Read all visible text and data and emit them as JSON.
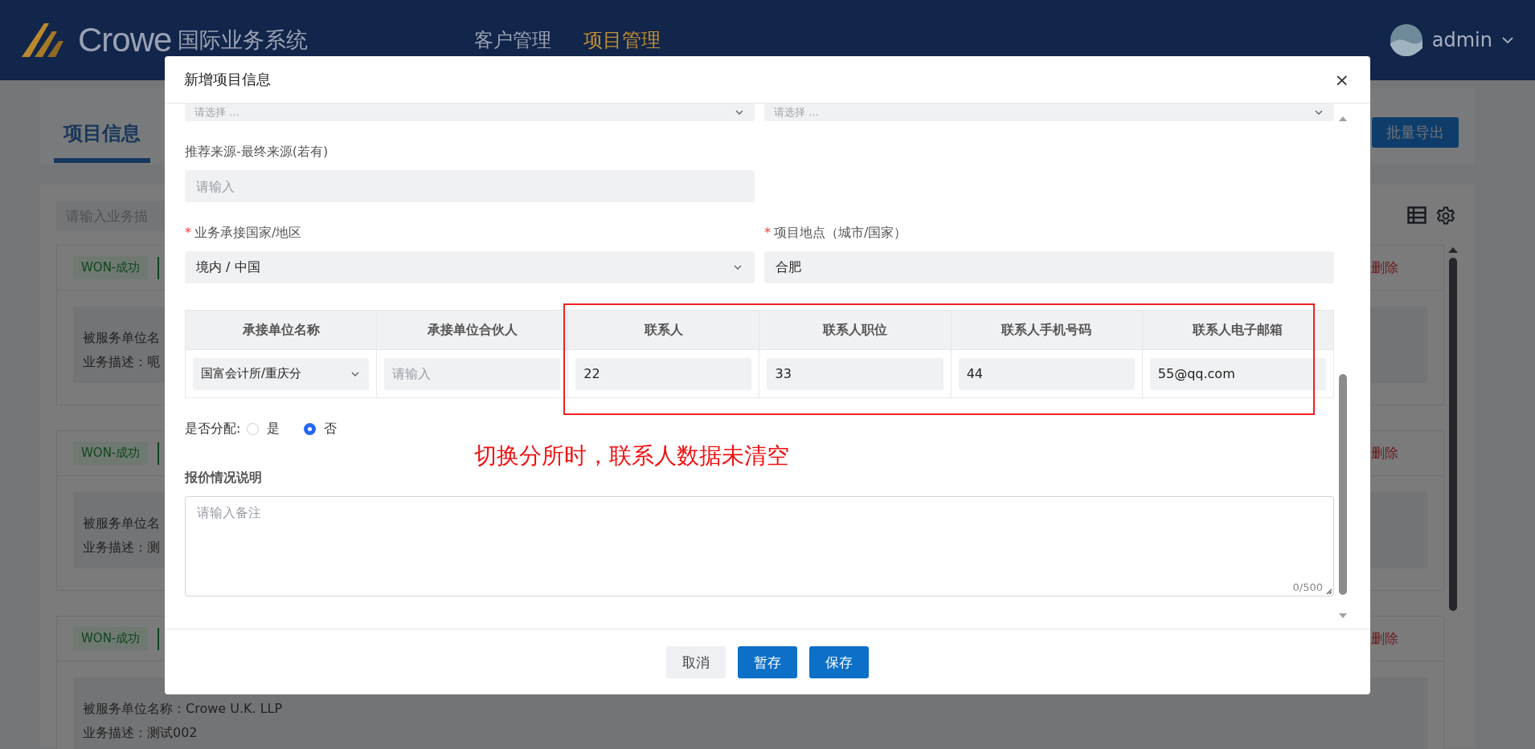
{
  "header": {
    "logo_text": "Crowe",
    "system_name": "国际业务系统",
    "nav": [
      {
        "label": "客户管理",
        "selected": false
      },
      {
        "label": "项目管理",
        "selected": true
      }
    ],
    "user": "admin"
  },
  "page": {
    "tab": {
      "label": "项目信息",
      "selected": true
    },
    "export_button": "批量导出",
    "search": {
      "placeholder": "请输入业务描"
    },
    "cards": [
      {
        "status": "WON-成功",
        "action": "删除",
        "lines": [
          "被服务单位名",
          "业务描述：呃"
        ]
      },
      {
        "status": "WON-成功",
        "action": "删除",
        "lines": [
          "被服务单位名",
          "业务描述：测"
        ]
      },
      {
        "status": "WON-成功",
        "action": "删除",
        "lines": [
          "被服务单位名称：Crowe U.K. LLP",
          "业务描述：测试002"
        ]
      }
    ]
  },
  "dialog": {
    "title": "新增项目信息",
    "close": "×",
    "required_mark": "*",
    "top_selects": [
      {
        "placeholder": "请选择 ..."
      },
      {
        "placeholder": "请选择 ..."
      }
    ],
    "rows": [
      [
        {
          "label": "推荐来源-最终来源(若有)",
          "required": false,
          "kind": "input",
          "placeholder": "请输入"
        }
      ],
      [
        {
          "label": "业务承接国家/地区",
          "required": true,
          "kind": "select",
          "value": "境内 / 中国"
        },
        {
          "label": "项目地点（城市/国家）",
          "required": true,
          "kind": "input",
          "value": "合肥"
        }
      ]
    ],
    "table": {
      "columns": [
        "承接单位名称",
        "承接单位合伙人",
        "联系人",
        "联系人职位",
        "联系人手机号码",
        "联系人电子邮箱"
      ],
      "rows": [
        [
          {
            "kind": "select",
            "value": "国富会计所/重庆分"
          },
          {
            "kind": "input",
            "placeholder": "请输入"
          },
          {
            "kind": "input",
            "value": "22"
          },
          {
            "kind": "input",
            "value": "33"
          },
          {
            "kind": "input",
            "value": "44"
          },
          {
            "kind": "input",
            "value": "55@qq.com"
          }
        ]
      ]
    },
    "assign": {
      "label": "是否分配:",
      "options": [
        {
          "label": "是",
          "selected": false
        },
        {
          "label": "否",
          "selected": true
        }
      ]
    },
    "annotation": "切换分所时，联系人数据未清空",
    "note": {
      "label": "报价情况说明",
      "placeholder": "请输入备注",
      "counter": "0/500"
    },
    "buttons": [
      {
        "label": "取消",
        "kind": "default"
      },
      {
        "label": "暂存",
        "kind": "primary"
      },
      {
        "label": "保存",
        "kind": "primary"
      }
    ]
  }
}
